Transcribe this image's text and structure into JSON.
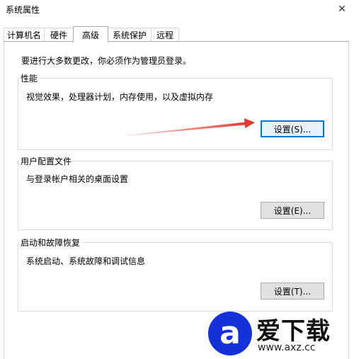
{
  "window": {
    "title": "系统属性",
    "close_glyph": "✕"
  },
  "tabs": [
    {
      "label": "计算机名",
      "active": false
    },
    {
      "label": "硬件",
      "active": false
    },
    {
      "label": "高级",
      "active": true
    },
    {
      "label": "系统保护",
      "active": false
    },
    {
      "label": "远程",
      "active": false
    }
  ],
  "main": {
    "admin_notice": "要进行大多数更改，你必须作为管理员登录。",
    "performance": {
      "title": "性能",
      "description": "视觉效果，处理器计划，内存使用，以及虚拟内存",
      "button_label": "设置(S)..."
    },
    "user_profiles": {
      "title": "用户配置文件",
      "description": "与登录帐户相关的桌面设置",
      "button_label": "设置(E)..."
    },
    "startup_recovery": {
      "title": "启动和故障恢复",
      "description": "系统启动、系统故障和调试信息",
      "button_label": "设置(T)..."
    }
  },
  "annotation": {
    "arrow_color": "#e03a2e"
  },
  "watermark": {
    "logo_letter": "a",
    "name": "爱下载",
    "url": "www.axz.cc",
    "color": "#1432d8"
  }
}
